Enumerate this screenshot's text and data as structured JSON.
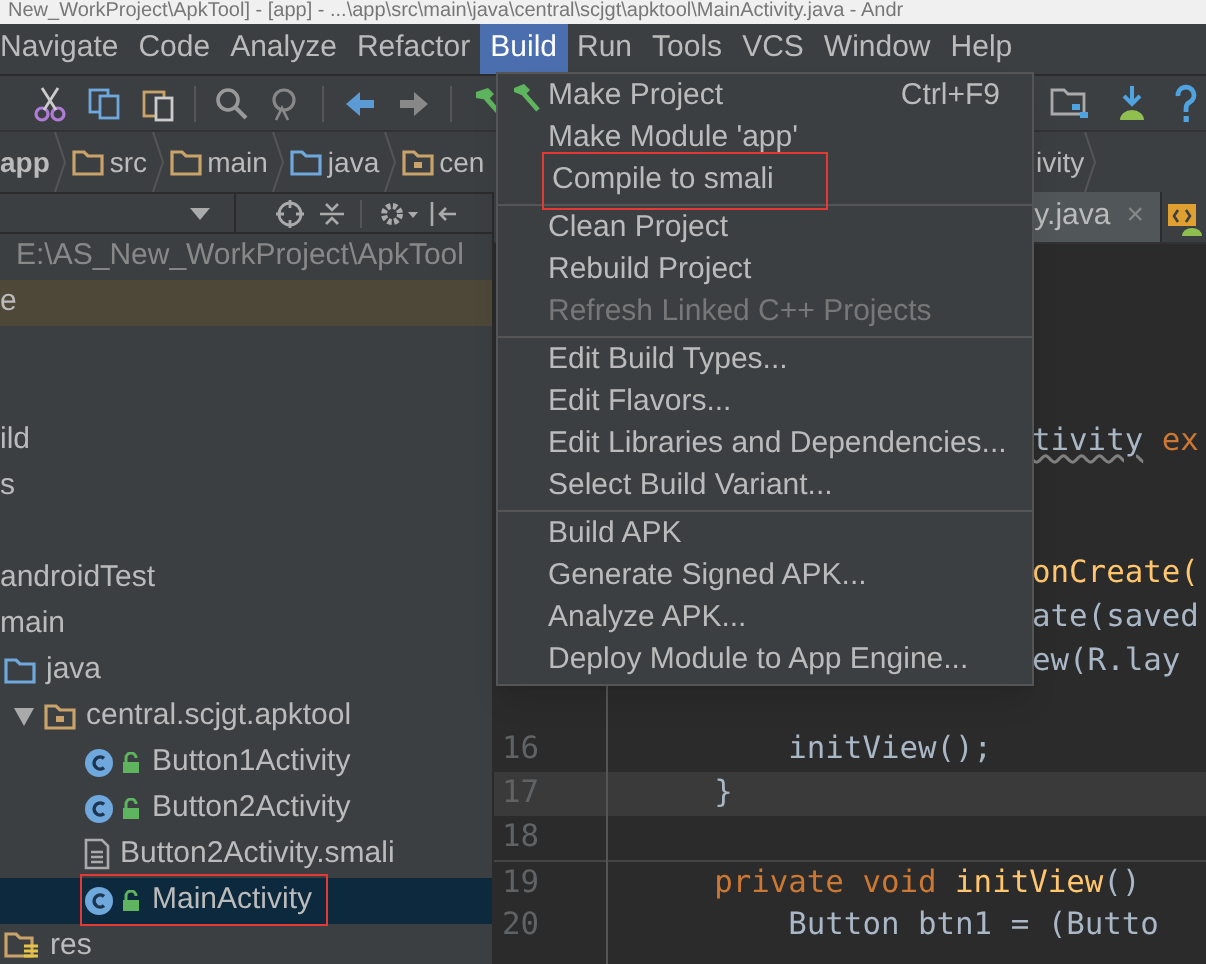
{
  "title_bar": {
    "title": "New_WorkProject\\ApkTool] - [app] - ...\\app\\src\\main\\java\\central\\scjgt\\apktool\\MainActivity.java - Andr"
  },
  "menu_bar": [
    {
      "label": "Navigate",
      "selected": false
    },
    {
      "label": "Code",
      "selected": false
    },
    {
      "label": "Analyze",
      "selected": false
    },
    {
      "label": "Refactor",
      "selected": false
    },
    {
      "label": "Build",
      "selected": true
    },
    {
      "label": "Run",
      "selected": false
    },
    {
      "label": "Tools",
      "selected": false
    },
    {
      "label": "VCS",
      "selected": false
    },
    {
      "label": "Window",
      "selected": false
    },
    {
      "label": "Help",
      "selected": false
    }
  ],
  "breadcrumb": [
    {
      "label": "app",
      "kind": "module"
    },
    {
      "label": "src",
      "kind": "folder"
    },
    {
      "label": "main",
      "kind": "folder"
    },
    {
      "label": "java",
      "kind": "source"
    },
    {
      "label": "cen",
      "kind": "package"
    },
    {
      "label": "ivity",
      "kind": "fragment"
    }
  ],
  "project_panel": {
    "path": "E:\\AS_New_WorkProject\\ApkTool",
    "tree": [
      {
        "label": "e",
        "kind": "module"
      },
      {
        "label": "ild"
      },
      {
        "label": "s"
      },
      {
        "label": "androidTest"
      },
      {
        "label": "main",
        "children": [
          {
            "label": "java",
            "kind": "source",
            "children": [
              {
                "label": "central.scjgt.apktool",
                "kind": "package",
                "expanded": true,
                "children": [
                  {
                    "label": "Button1Activity",
                    "kind": "class",
                    "selected": false,
                    "annotated": false
                  },
                  {
                    "label": "Button2Activity",
                    "kind": "class",
                    "selected": false,
                    "annotated": false
                  },
                  {
                    "label": "Button2Activity.smali",
                    "kind": "file",
                    "selected": false,
                    "annotated": false
                  },
                  {
                    "label": "MainActivity",
                    "kind": "class",
                    "selected": true,
                    "annotated": true
                  }
                ]
              }
            ]
          },
          {
            "label": "res",
            "kind": "res"
          }
        ]
      }
    ]
  },
  "build_menu": {
    "groups": [
      [
        {
          "label": "Make Project",
          "shortcut": "Ctrl+F9",
          "has_icon": true,
          "disabled": false,
          "annotated": false
        },
        {
          "label": "Make Module 'app'",
          "disabled": false,
          "annotated": false
        },
        {
          "label": "Compile to smali",
          "disabled": false,
          "annotated": true
        }
      ],
      [
        {
          "label": "Clean Project",
          "disabled": false,
          "annotated": false
        },
        {
          "label": "Rebuild Project",
          "disabled": false,
          "annotated": false
        },
        {
          "label": "Refresh Linked C++ Projects",
          "disabled": true,
          "annotated": false
        }
      ],
      [
        {
          "label": "Edit Build Types...",
          "disabled": false,
          "annotated": false
        },
        {
          "label": "Edit Flavors...",
          "disabled": false,
          "annotated": false
        },
        {
          "label": "Edit Libraries and Dependencies...",
          "disabled": false,
          "annotated": false
        },
        {
          "label": "Select Build Variant...",
          "disabled": false,
          "annotated": false
        }
      ],
      [
        {
          "label": "Build APK",
          "disabled": false,
          "annotated": false
        },
        {
          "label": "Generate Signed APK...",
          "disabled": false,
          "annotated": false
        },
        {
          "label": "Analyze APK...",
          "disabled": false,
          "annotated": false
        },
        {
          "label": "Deploy Module to App Engine...",
          "disabled": false,
          "annotated": false
        }
      ]
    ]
  },
  "editor": {
    "tabs": [
      {
        "label": "y.java",
        "close": "×",
        "selected": true
      }
    ],
    "lines": [
      {
        "kind": "fragment",
        "tokens": [
          {
            "text": "tivity",
            "kind": "warning"
          },
          {
            "text": " ex",
            "kind": "keyword"
          }
        ]
      },
      {
        "kind": "fragment",
        "tokens": [
          {
            "text": "onCreate(",
            "kind": "method"
          }
        ]
      },
      {
        "kind": "fragment",
        "tokens": [
          {
            "text": "ate(saved"
          }
        ]
      },
      {
        "kind": "fragment",
        "tokens": [
          {
            "text": "ew(R.lay"
          }
        ]
      },
      {
        "kind": "line",
        "number": "16",
        "tokens": [
          {
            "text": "        initView();"
          }
        ]
      },
      {
        "kind": "line",
        "number": "17",
        "current": true,
        "tokens": [
          {
            "text": "    }"
          }
        ]
      },
      {
        "kind": "line",
        "number": "18"
      },
      {
        "kind": "line",
        "number": "19",
        "tokens": [
          {
            "text": "    private void ",
            "kind": "keyword"
          },
          {
            "text": "initView",
            "kind": "method"
          },
          {
            "text": "()"
          }
        ]
      },
      {
        "kind": "line",
        "number": "20",
        "tokens": [
          {
            "text": "        Button btn1 = (Butto"
          }
        ]
      }
    ]
  }
}
